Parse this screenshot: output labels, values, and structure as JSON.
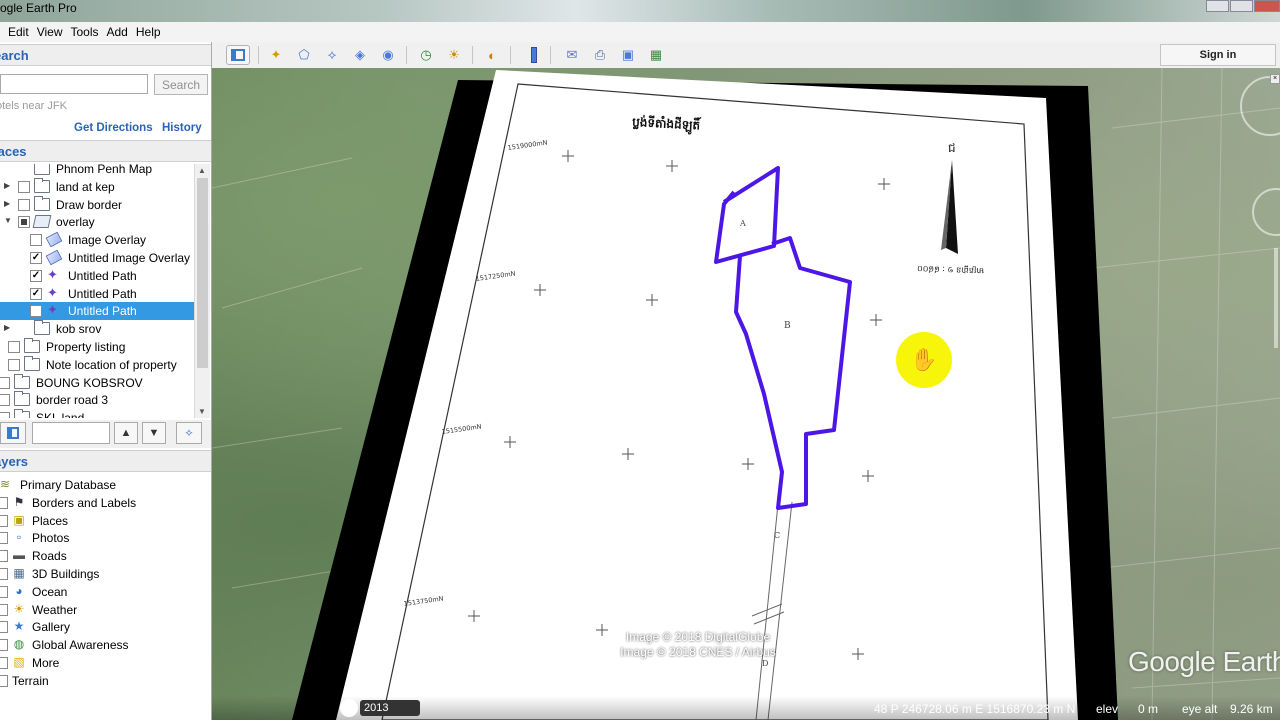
{
  "window": {
    "title": "ogle Earth Pro"
  },
  "menu": [
    "Edit",
    "View",
    "Tools",
    "Add",
    "Help"
  ],
  "toolbar": {
    "sign_in": "Sign in",
    "buttons": [
      {
        "name": "sidebar-toggle",
        "icon": "sidebar-icon"
      },
      {
        "name": "add-placemark",
        "icon": "placemark-icon"
      },
      {
        "name": "add-polygon",
        "icon": "polygon-icon"
      },
      {
        "name": "add-path",
        "icon": "path-icon"
      },
      {
        "name": "add-image-overlay",
        "icon": "image-overlay-icon"
      },
      {
        "name": "record-tour",
        "icon": "record-tour-icon"
      },
      {
        "name": "historical-imagery",
        "icon": "clock-icon"
      },
      {
        "name": "sunlight",
        "icon": "sun-icon"
      },
      {
        "name": "switch-to-sky",
        "icon": "planet-icon"
      },
      {
        "name": "ruler",
        "icon": "ruler-icon"
      },
      {
        "name": "email",
        "icon": "email-icon"
      },
      {
        "name": "print",
        "icon": "print-icon"
      },
      {
        "name": "save-image",
        "icon": "save-image-icon"
      },
      {
        "name": "view-in-maps",
        "icon": "maps-icon"
      }
    ]
  },
  "search": {
    "header": "earch",
    "button": "Search",
    "hint": "otels near JFK",
    "get_directions": "Get Directions",
    "history": "History",
    "input_value": ""
  },
  "places": {
    "header": "laces",
    "items": [
      {
        "label": "Phnom Penh Map",
        "indent": 1,
        "expander": false,
        "checkbox": "none",
        "icon": "folder"
      },
      {
        "label": "land at kep",
        "indent": 1,
        "expander": true,
        "checkbox": "empty",
        "icon": "folder"
      },
      {
        "label": "Draw border",
        "indent": 1,
        "expander": true,
        "checkbox": "empty",
        "icon": "folder"
      },
      {
        "label": "overlay",
        "indent": 1,
        "expander": "open",
        "checkbox": "partial",
        "icon": "folder-open"
      },
      {
        "label": "Image Overlay",
        "indent": 2,
        "expander": false,
        "checkbox": "empty",
        "icon": "overlay"
      },
      {
        "label": "Untitled Image Overlay",
        "indent": 2,
        "expander": false,
        "checkbox": "checked",
        "icon": "overlay"
      },
      {
        "label": "Untitled Path",
        "indent": 2,
        "expander": false,
        "checkbox": "checked",
        "icon": "path"
      },
      {
        "label": "Untitled Path",
        "indent": 2,
        "expander": false,
        "checkbox": "checked",
        "icon": "path"
      },
      {
        "label": "Untitled Path",
        "indent": 2,
        "expander": false,
        "checkbox": "checked",
        "icon": "path",
        "selected": true
      },
      {
        "label": "kob srov",
        "indent": 1,
        "expander": true,
        "checkbox": "none",
        "icon": "folder"
      },
      {
        "label": "Property listing",
        "indent": 0,
        "expander": false,
        "checkbox": "empty",
        "icon": "folder"
      },
      {
        "label": "Note location of property",
        "indent": 0,
        "expander": false,
        "checkbox": "empty",
        "icon": "folder"
      },
      {
        "label": "BOUNG KOBSROV",
        "indent": -1,
        "expander": false,
        "checkbox": "empty",
        "icon": "folder"
      },
      {
        "label": "border road 3",
        "indent": -1,
        "expander": false,
        "checkbox": "empty",
        "icon": "folder"
      },
      {
        "label": "SKL land",
        "indent": -1,
        "expander": false,
        "checkbox": "empty",
        "icon": "folder"
      }
    ]
  },
  "layers": {
    "header": "ayers",
    "items": [
      {
        "label": "Primary Database",
        "icon": "database-icon",
        "glyph": "≋",
        "color": "#7a8a2a"
      },
      {
        "label": "Borders and Labels",
        "icon": "borders-icon",
        "glyph": "⚑",
        "color": "#334"
      },
      {
        "label": "Places",
        "icon": "places-icon",
        "glyph": "▣",
        "color": "#b8a400"
      },
      {
        "label": "Photos",
        "icon": "photos-icon",
        "glyph": "▫",
        "color": "#2a6bd0"
      },
      {
        "label": "Roads",
        "icon": "roads-icon",
        "glyph": "▬",
        "color": "#555"
      },
      {
        "label": "3D Buildings",
        "icon": "buildings-icon",
        "glyph": "▦",
        "color": "#4a6a8a"
      },
      {
        "label": "Ocean",
        "icon": "ocean-icon",
        "glyph": "◕",
        "color": "#2c6fd8"
      },
      {
        "label": "Weather",
        "icon": "weather-icon",
        "glyph": "☀",
        "color": "#d09000"
      },
      {
        "label": "Gallery",
        "icon": "gallery-icon",
        "glyph": "★",
        "color": "#3d7bd8"
      },
      {
        "label": "Global Awareness",
        "icon": "globe-icon",
        "glyph": "◍",
        "color": "#3a8a3a"
      },
      {
        "label": "More",
        "icon": "more-icon",
        "glyph": "▧",
        "color": "#e0b000"
      },
      {
        "label": "Terrain",
        "icon": "terrain-icon",
        "glyph": "",
        "color": "#666"
      }
    ]
  },
  "map": {
    "document_title": "ប្លង់ទីតាំងដីឡូតិ៍",
    "scale_label": "មាត្រដ្ឋាន ១ : ៨៨០០",
    "north_label": "ជ",
    "grid_labels": [
      "1519000mN",
      "1517250mN",
      "1515500mN",
      "1513750mN"
    ],
    "parcel_labels": [
      "A",
      "B",
      "C",
      "D"
    ],
    "credits": [
      "Image © 2018 DigitalGlobe",
      "Image © 2018 CNES / Airbus"
    ],
    "logo": "Google Earth",
    "path_color": "#4b16e6",
    "cursor_color": "#f7f50a"
  },
  "status": {
    "year": "2013",
    "coords": "48 P 246728.06 m E 1516870.23 m N",
    "elev_label": "elev",
    "elev_value": "0 m",
    "eye_label": "eye alt",
    "eye_value": "9.26 km"
  }
}
